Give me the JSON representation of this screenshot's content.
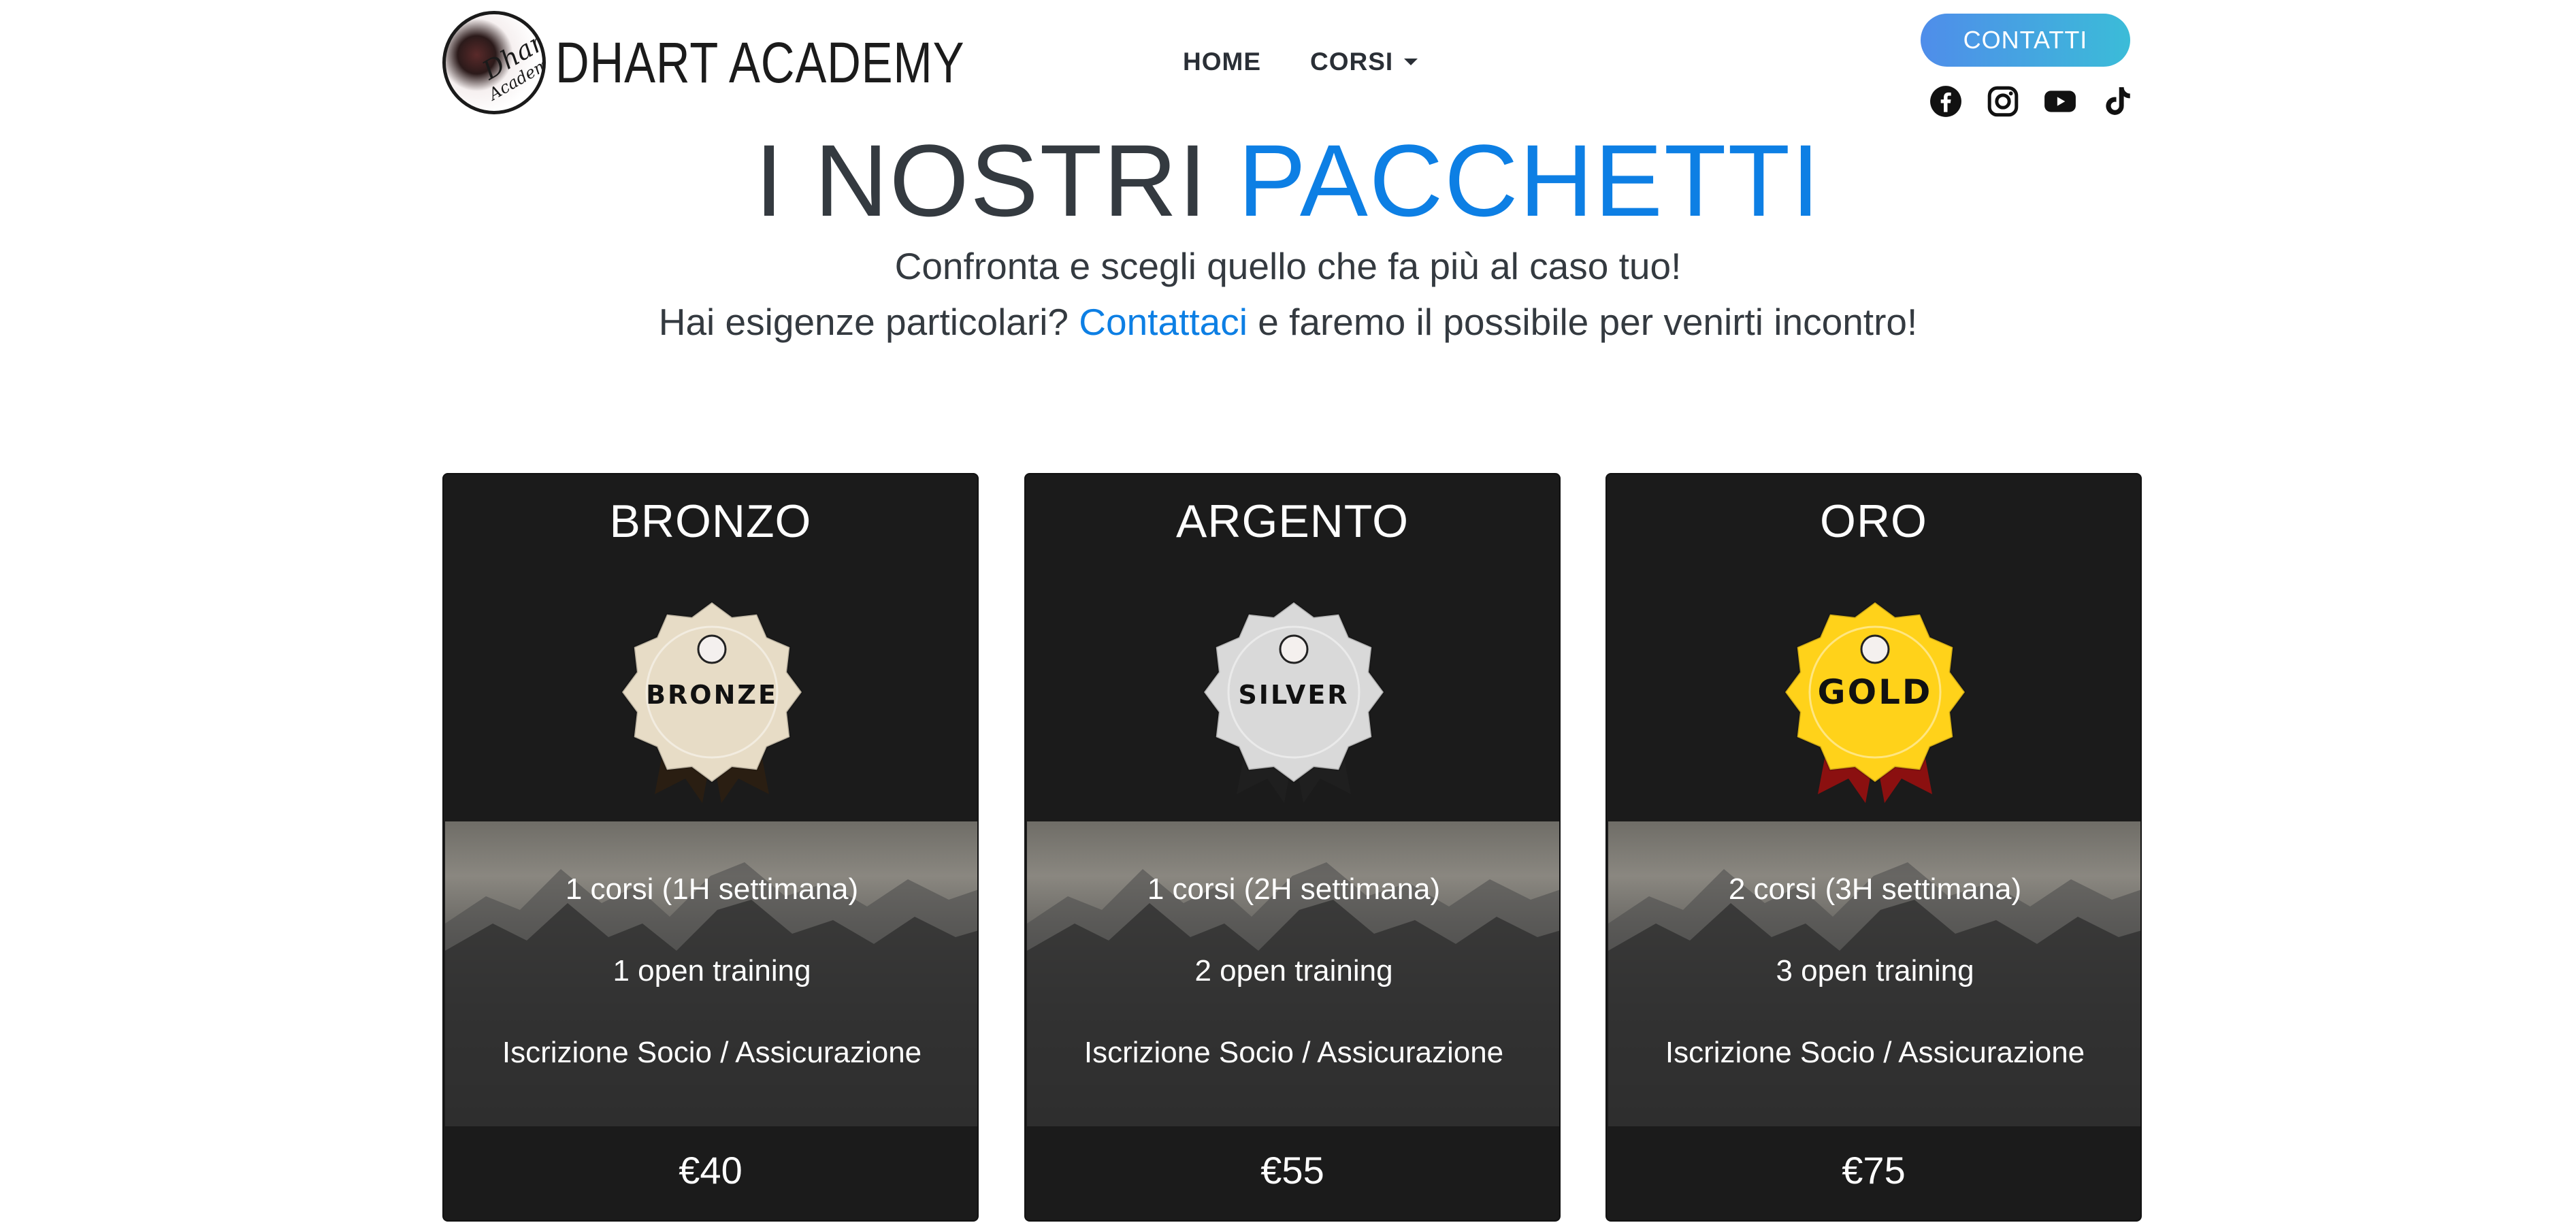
{
  "header": {
    "logo_text": "DHART ACADEMY",
    "logo_badge_line1": "Dhart",
    "logo_badge_line2": "Academy",
    "nav": [
      {
        "label": "HOME"
      },
      {
        "label": "CORSI"
      }
    ],
    "contact_button": "CONTATTI",
    "social_icons": [
      "facebook-icon",
      "instagram-icon",
      "youtube-icon",
      "tiktok-icon"
    ]
  },
  "hero": {
    "title_part1": "I NOSTRI ",
    "title_part2": "PACCHETTI",
    "subtitle_line1": "Confronta e scegli quello che fa più al caso tuo!",
    "subtitle_line2_before": "Hai esigenze particolari? ",
    "subtitle_link": "Contattaci",
    "subtitle_line2_after": " e faremo il possibile per venirti incontro!"
  },
  "packages": [
    {
      "title": "BRONZO",
      "medal_label": "BRONZE",
      "medal_color": "#e7dcc6",
      "ribbon_color": "#2a1e12",
      "features": [
        "1 corsi (1H settimana)",
        "1 open training",
        "Iscrizione Socio / Assicurazione"
      ],
      "price": "€40"
    },
    {
      "title": "ARGENTO",
      "medal_label": "SILVER",
      "medal_color": "#d9d9d9",
      "ribbon_color": "#1f1f1f",
      "features": [
        "1 corsi (2H settimana)",
        "2 open training",
        "Iscrizione Socio / Assicurazione"
      ],
      "price": "€55"
    },
    {
      "title": "ORO",
      "medal_label": "GOLD",
      "medal_color": "#ffd21a",
      "ribbon_color": "#8b1010",
      "features": [
        "2 corsi (3H settimana)",
        "3 open training",
        "Iscrizione Socio / Assicurazione"
      ],
      "price": "€75"
    }
  ],
  "colors": {
    "accent": "#0d7fe4",
    "card_bg": "#1b1b1b",
    "button_gradient_start": "#4f8dea",
    "button_gradient_end": "#3bbcd8"
  }
}
